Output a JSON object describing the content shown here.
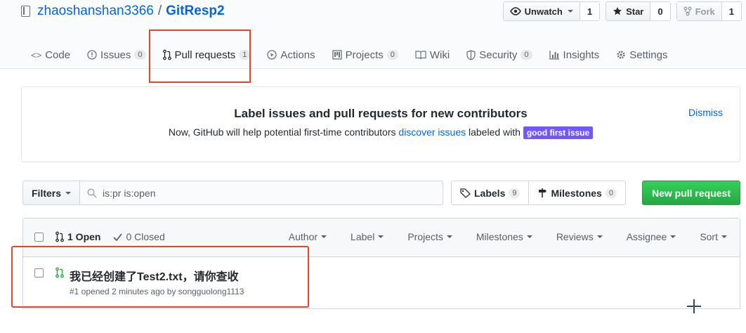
{
  "repo": {
    "owner": "zhaoshanshan3366",
    "separator": "/",
    "name": "GitResp2"
  },
  "actions": {
    "watch_label": "Unwatch",
    "watch_count": "1",
    "star_label": "Star",
    "star_count": "0",
    "fork_label": "Fork",
    "fork_count": "1"
  },
  "nav": {
    "code": "Code",
    "issues": "Issues",
    "issues_count": "0",
    "pull_requests": "Pull requests",
    "pull_requests_count": "1",
    "actions": "Actions",
    "projects": "Projects",
    "projects_count": "0",
    "wiki": "Wiki",
    "security": "Security",
    "security_count": "0",
    "insights": "Insights",
    "settings": "Settings"
  },
  "banner": {
    "title": "Label issues and pull requests for new contributors",
    "text_before": "Now, GitHub will help potential first-time contributors ",
    "link": "discover issues",
    "text_after": " labeled with ",
    "label": "good first issue",
    "dismiss": "Dismiss"
  },
  "filters": {
    "button": "Filters",
    "query": "is:pr is:open",
    "labels": "Labels",
    "labels_count": "9",
    "milestones": "Milestones",
    "milestones_count": "0",
    "new_pr": "New pull request"
  },
  "list": {
    "open": "1 Open",
    "closed": "0 Closed",
    "menus": {
      "author": "Author",
      "label": "Label",
      "projects": "Projects",
      "milestones": "Milestones",
      "reviews": "Reviews",
      "assignee": "Assignee",
      "sort": "Sort"
    },
    "items": [
      {
        "title": "我已经创建了Test2.txt，请你查收",
        "meta": "#1 opened 2 minutes ago by songguolong1113"
      }
    ]
  },
  "colors": {
    "link": "#0366d6",
    "highlight_box": "#e0452f",
    "good_first_issue": "#7057ff",
    "new_pr_button": "#28a745",
    "open_pr_icon": "#28a745"
  }
}
